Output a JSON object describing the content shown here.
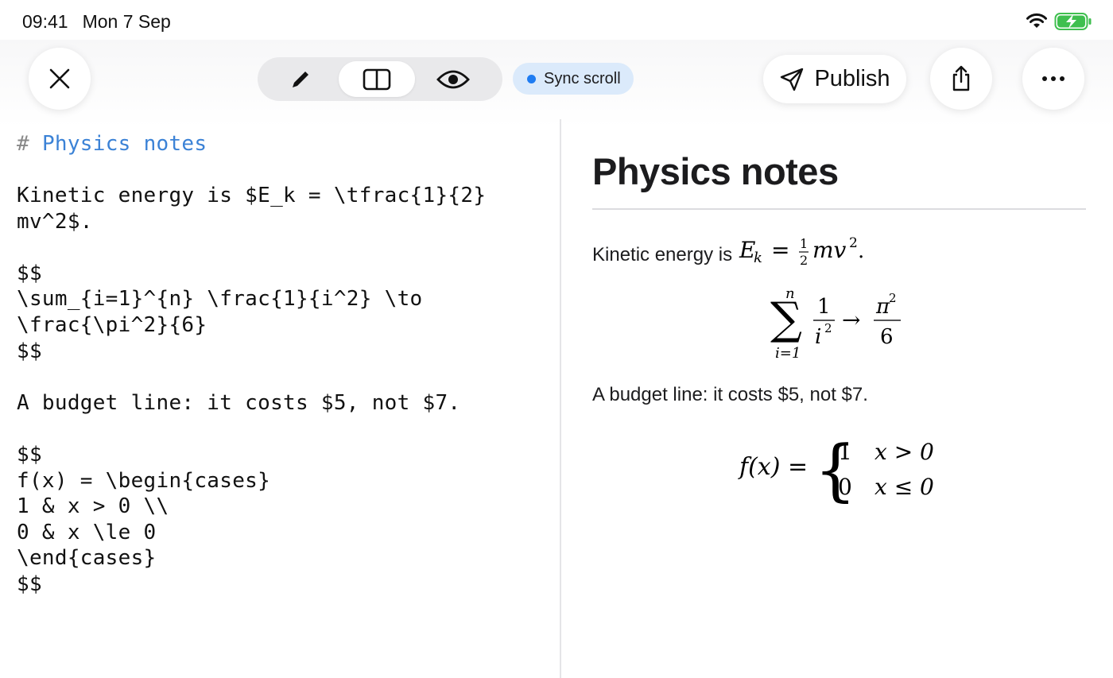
{
  "status_bar": {
    "time": "09:41",
    "date": "Mon 7 Sep"
  },
  "toolbar": {
    "close_icon": "close-icon",
    "modes": [
      {
        "name": "edit",
        "icon": "pencil-icon",
        "active": false
      },
      {
        "name": "split",
        "icon": "split-view-icon",
        "active": true
      },
      {
        "name": "preview",
        "icon": "eye-icon",
        "active": false
      }
    ],
    "sync_scroll_label": "Sync scroll",
    "publish_label": "Publish",
    "share_icon": "share-icon",
    "more_icon": "more-icon"
  },
  "editor": {
    "heading_hash": "#",
    "heading_text": "Physics notes",
    "lines": [
      "Kinetic energy is $E_k = \\tfrac{1}{2}",
      "mv^2$.",
      "",
      "$$",
      "\\sum_{i=1}^{n} \\frac{1}{i^2} \\to",
      "\\frac{\\pi^2}{6}",
      "$$",
      "",
      "A budget line: it costs $5, not $7.",
      "",
      "$$",
      "f(x) = \\begin{cases}",
      "1 & x > 0 \\\\",
      "0 & x \\le 0",
      "\\end{cases}",
      "$$"
    ]
  },
  "preview": {
    "title": "Physics notes",
    "para1_prefix": "Kinetic energy is",
    "para2": "A budget line: it costs $5, not $7.",
    "sum_upper": "n",
    "sum_lower": "i=1",
    "frac1_num": "1",
    "frac1_den": "i",
    "frac2_num": "π",
    "frac2_den": "6",
    "cases_lhs": "f(x) =",
    "case1_value": "1",
    "case1_cond": "x > 0",
    "case2_value": "0",
    "case2_cond": "x ≤ 0"
  },
  "colors": {
    "accent": "#1e7cf2",
    "heading": "#3b82d6",
    "sync_bg": "#dbeafb"
  }
}
